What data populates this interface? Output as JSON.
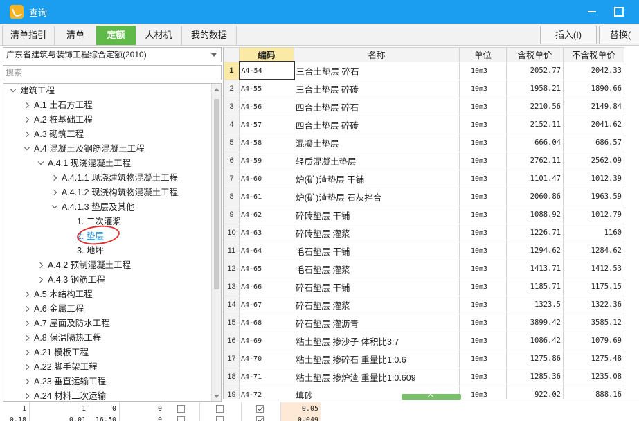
{
  "window": {
    "title": "查询"
  },
  "tabs": [
    "清单指引",
    "清单",
    "定额",
    "人材机",
    "我的数据"
  ],
  "active_tab": 2,
  "toolbar": {
    "insert_label": "插入(I)",
    "replace_label": "替换("
  },
  "library": {
    "selected": "广东省建筑与装饰工程综合定额(2010)"
  },
  "search": {
    "placeholder": "搜索"
  },
  "tree": [
    {
      "label": "建筑工程",
      "level": 0,
      "state": "open"
    },
    {
      "label": "A.1 土石方工程",
      "level": 1,
      "state": "closed"
    },
    {
      "label": "A.2 桩基础工程",
      "level": 1,
      "state": "closed"
    },
    {
      "label": "A.3 砌筑工程",
      "level": 1,
      "state": "closed"
    },
    {
      "label": "A.4 混凝土及钢筋混凝土工程",
      "level": 1,
      "state": "open"
    },
    {
      "label": "A.4.1 现浇混凝土工程",
      "level": 2,
      "state": "open"
    },
    {
      "label": "A.4.1.1 现浇建筑物混凝土工程",
      "level": 3,
      "state": "closed"
    },
    {
      "label": "A.4.1.2 现浇构筑物混凝土工程",
      "level": 3,
      "state": "closed"
    },
    {
      "label": "A.4.1.3 垫层及其他",
      "level": 3,
      "state": "open"
    },
    {
      "label": "1. 二次灌浆",
      "level": 4,
      "state": "leaf"
    },
    {
      "label": "2. 垫层",
      "level": 4,
      "state": "leaf",
      "selected": true
    },
    {
      "label": "3. 地坪",
      "level": 4,
      "state": "leaf"
    },
    {
      "label": "A.4.2 预制混凝土工程",
      "level": 2,
      "state": "closed"
    },
    {
      "label": "A.4.3 钢筋工程",
      "level": 2,
      "state": "closed"
    },
    {
      "label": "A.5 木结构工程",
      "level": 1,
      "state": "closed"
    },
    {
      "label": "A.6 金属工程",
      "level": 1,
      "state": "closed"
    },
    {
      "label": "A.7 屋面及防水工程",
      "level": 1,
      "state": "closed"
    },
    {
      "label": "A.8 保温隔热工程",
      "level": 1,
      "state": "closed"
    },
    {
      "label": "A.21 模板工程",
      "level": 1,
      "state": "closed"
    },
    {
      "label": "A.22 脚手架工程",
      "level": 1,
      "state": "closed"
    },
    {
      "label": "A.23 垂直运输工程",
      "level": 1,
      "state": "closed"
    },
    {
      "label": "A.24 材料二次运输",
      "level": 1,
      "state": "closed"
    }
  ],
  "grid": {
    "columns": [
      "",
      "编码",
      "名称",
      "单位",
      "含税单价",
      "不含税单价"
    ],
    "rows": [
      [
        "1",
        "A4-54",
        "三合土垫层 碎石",
        "10m3",
        "2052.77",
        "2042.33"
      ],
      [
        "2",
        "A4-55",
        "三合土垫层 碎砖",
        "10m3",
        "1958.21",
        "1890.66"
      ],
      [
        "3",
        "A4-56",
        "四合土垫层 碎石",
        "10m3",
        "2210.56",
        "2149.84"
      ],
      [
        "4",
        "A4-57",
        "四合土垫层 碎砖",
        "10m3",
        "2152.11",
        "2041.62"
      ],
      [
        "5",
        "A4-58",
        "混凝土垫层",
        "10m3",
        "666.04",
        "686.57"
      ],
      [
        "6",
        "A4-59",
        "轻质混凝土垫层",
        "10m3",
        "2762.11",
        "2562.09"
      ],
      [
        "7",
        "A4-60",
        "炉(矿)渣垫层 干铺",
        "10m3",
        "1101.47",
        "1012.39"
      ],
      [
        "8",
        "A4-61",
        "炉(矿)渣垫层 石灰拌合",
        "10m3",
        "2060.86",
        "1963.59"
      ],
      [
        "9",
        "A4-62",
        "碎砖垫层 干铺",
        "10m3",
        "1088.92",
        "1012.79"
      ],
      [
        "10",
        "A4-63",
        "碎砖垫层 灌浆",
        "10m3",
        "1226.71",
        "1160"
      ],
      [
        "11",
        "A4-64",
        "毛石垫层 干铺",
        "10m3",
        "1294.62",
        "1284.62"
      ],
      [
        "12",
        "A4-65",
        "毛石垫层 灌浆",
        "10m3",
        "1413.71",
        "1412.53"
      ],
      [
        "13",
        "A4-66",
        "碎石垫层 干铺",
        "10m3",
        "1185.71",
        "1175.15"
      ],
      [
        "14",
        "A4-67",
        "碎石垫层 灌浆",
        "10m3",
        "1323.5",
        "1322.36"
      ],
      [
        "15",
        "A4-68",
        "碎石垫层 灌沥青",
        "10m3",
        "3899.42",
        "3585.12"
      ],
      [
        "16",
        "A4-69",
        "粘土垫层 掺沙子 体积比3:7",
        "10m3",
        "1086.42",
        "1079.69"
      ],
      [
        "17",
        "A4-70",
        "粘土垫层 掺碎石 重量比1:0.6",
        "10m3",
        "1275.86",
        "1275.48"
      ],
      [
        "18",
        "A4-71",
        "粘土垫层 掺炉渣 重量比1:0.609",
        "10m3",
        "1285.36",
        "1235.08"
      ],
      [
        "19",
        "A4-72",
        "填砂",
        "10m3",
        "922.02",
        "888.16"
      ]
    ]
  },
  "bottom": {
    "v1": "1",
    "v2": "1",
    "v3": "0",
    "v4": "0",
    "v5": "0.05",
    "v6": "0.18",
    "v7": "0.01",
    "v8": "16.50",
    "v9": "0",
    "v10": "0.049"
  }
}
